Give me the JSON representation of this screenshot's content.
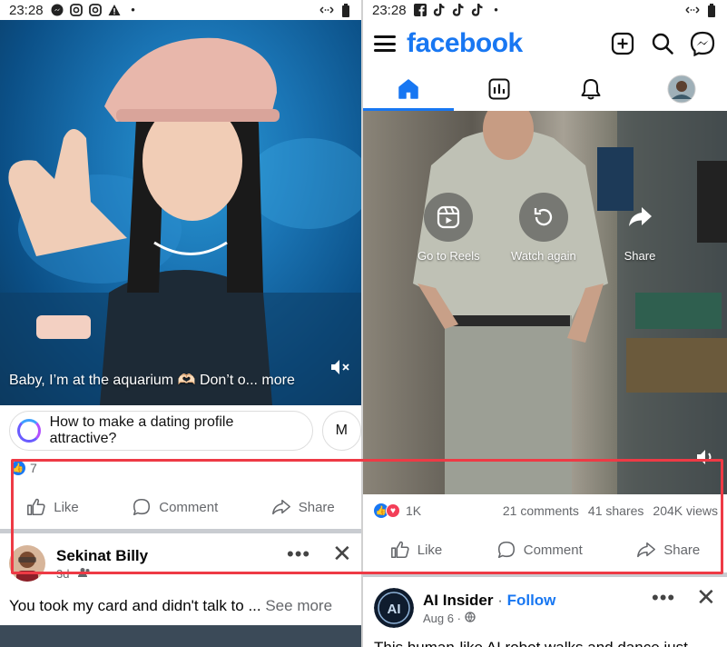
{
  "left": {
    "status": {
      "time": "23:28"
    },
    "video": {
      "caption": "Baby, I’m at the aquarium 🫶🏻 Don’t o...",
      "caption_more": " more"
    },
    "chips": [
      "How to make a dating profile attractive?",
      "M"
    ],
    "reactions": {
      "count": "7"
    },
    "actions": {
      "like": "Like",
      "comment": "Comment",
      "share": "Share"
    },
    "post": {
      "author": "Sekinat Billy",
      "age": "3d",
      "text": "You took my card and didn't talk to ...",
      "see_more": " See more"
    }
  },
  "right": {
    "status": {
      "time": "23:28"
    },
    "header": {
      "logo": "facebook"
    },
    "video": {
      "overlay": [
        {
          "label": "Go to Reels"
        },
        {
          "label": "Watch again"
        },
        {
          "label": "Share"
        }
      ]
    },
    "reactions": {
      "count": "1K"
    },
    "stats": {
      "comments": "21 comments",
      "shares": "41 shares",
      "views": "204K views"
    },
    "actions": {
      "like": "Like",
      "comment": "Comment",
      "share": "Share"
    },
    "post": {
      "author": "AI Insider",
      "follow_sep": " · ",
      "follow": "Follow",
      "date": "Aug 6 · ",
      "text": "This human-like AI robot walks and dance just..."
    }
  },
  "colors": {
    "brand": "#1877f2",
    "highlight": "#ee3a45",
    "like": "#1877f2",
    "love": "#f33e58"
  }
}
